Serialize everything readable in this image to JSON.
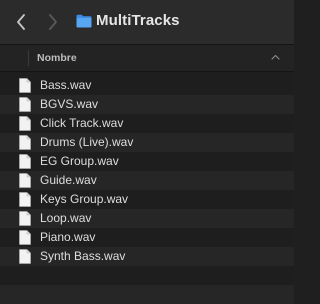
{
  "window": {
    "title": "MultiTracks"
  },
  "toolbar": {
    "back_icon": "chevron-left-icon",
    "forward_icon": "chevron-right-icon",
    "folder_icon": "folder-icon",
    "folder_color": "#3a8ee6"
  },
  "column_header": {
    "name_label": "Nombre",
    "sort_icon": "chevron-up-icon"
  },
  "files": [
    {
      "name": "Bass.wav"
    },
    {
      "name": "BGVS.wav"
    },
    {
      "name": "Click Track.wav"
    },
    {
      "name": "Drums (Live).wav"
    },
    {
      "name": "EG Group.wav"
    },
    {
      "name": "Guide.wav"
    },
    {
      "name": "Keys Group.wav"
    },
    {
      "name": "Loop.wav"
    },
    {
      "name": "Piano.wav"
    },
    {
      "name": "Synth Bass.wav"
    }
  ]
}
